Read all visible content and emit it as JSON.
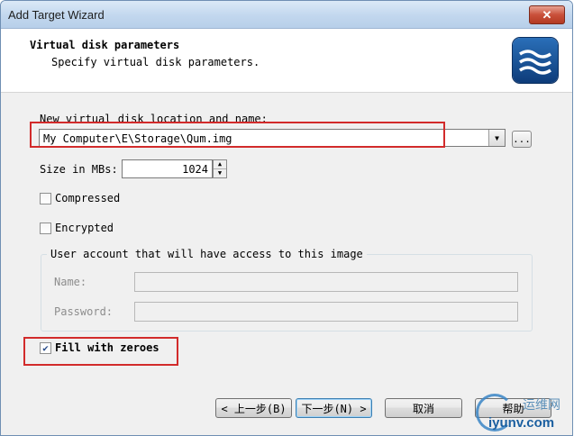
{
  "window": {
    "title": "Add Target Wizard",
    "close_glyph": "✕"
  },
  "header": {
    "title": "Virtual disk parameters",
    "subtitle": "Specify virtual disk parameters.",
    "logo_icon": "waves-logo-icon"
  },
  "location": {
    "label": "New virtual disk location and name:",
    "value": "My Computer\\E\\Storage\\Qum.img",
    "dropdown_glyph": "▼",
    "browse_label": "..."
  },
  "size": {
    "label": "Size in MBs:",
    "value": "1024",
    "up_glyph": "▲",
    "down_glyph": "▼"
  },
  "options": {
    "compressed": {
      "label": "Compressed",
      "checked": false
    },
    "encrypted": {
      "label": "Encrypted",
      "checked": false
    },
    "fill_zeroes": {
      "label": "Fill with zeroes",
      "checked": true,
      "check_glyph": "✔"
    }
  },
  "account": {
    "group_title": "User account that will have access to this image",
    "name_label": "Name:",
    "password_label": "Password:",
    "name_value": "",
    "password_value": ""
  },
  "buttons": {
    "back": "< 上一步(B)",
    "next": "下一步(N) >",
    "cancel": "取消",
    "help": "帮助"
  },
  "watermark": {
    "top": "运维网",
    "bottom": "iyunv.com"
  },
  "colors": {
    "highlight": "#d22b2b",
    "title_bar": "#c2d7ee",
    "dialog_bg": "#f0f0f0"
  }
}
